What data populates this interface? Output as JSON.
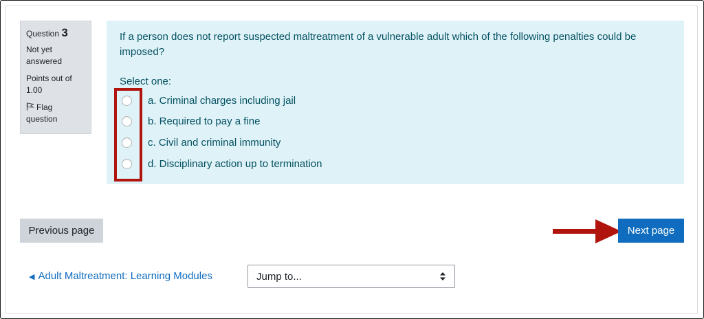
{
  "info": {
    "question_word": "Question",
    "question_number": "3",
    "state": "Not yet answered",
    "grade": "Points out of 1.00",
    "flag_label": "Flag question"
  },
  "question": {
    "text": "If a person does not report suspected maltreatment of a vulnerable adult which of the following penalties could be imposed?",
    "prompt": "Select one:",
    "options": [
      {
        "label": "a. Criminal charges including jail"
      },
      {
        "label": "b. Required to pay a fine"
      },
      {
        "label": "c. Civil and criminal immunity"
      },
      {
        "label": "d. Disciplinary action up to termination"
      }
    ]
  },
  "nav": {
    "previous_label": "Previous page",
    "next_label": "Next page"
  },
  "footer": {
    "back_link": "Adult Maltreatment: Learning Modules",
    "jump_placeholder": "Jump to..."
  },
  "colors": {
    "annotation_red": "#b0140c",
    "primary_blue": "#0f6cbf",
    "content_bg": "#def2f8",
    "info_bg": "#dee2e6"
  },
  "icons": [
    "flag-icon",
    "back-triangle-icon",
    "select-caret-icon",
    "annotation-arrow-icon"
  ]
}
